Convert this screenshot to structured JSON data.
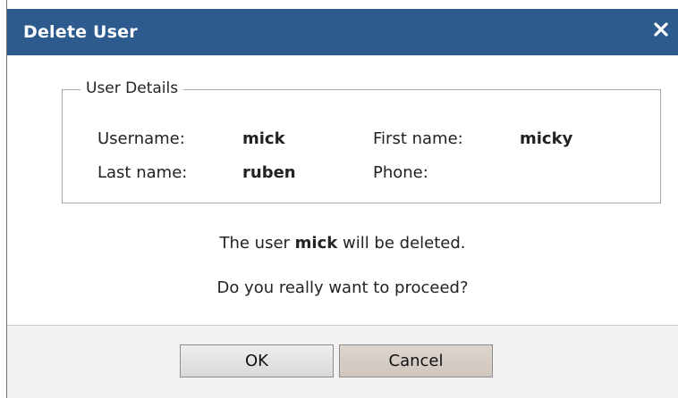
{
  "dialog": {
    "title": "Delete User",
    "close_icon": "close-icon",
    "header_color": "#2e5b8d"
  },
  "details": {
    "legend": "User Details",
    "username_label": "Username:",
    "username_value": "mick",
    "first_name_label": "First name:",
    "first_name_value": "micky",
    "last_name_label": "Last name:",
    "last_name_value": "ruben",
    "phone_label": "Phone:",
    "phone_value": ""
  },
  "message": {
    "line1_prefix": "The user ",
    "line1_user": "mick",
    "line1_suffix": " will be deleted.",
    "line2": "Do you really want to proceed?"
  },
  "buttons": {
    "ok": "OK",
    "cancel": "Cancel"
  }
}
